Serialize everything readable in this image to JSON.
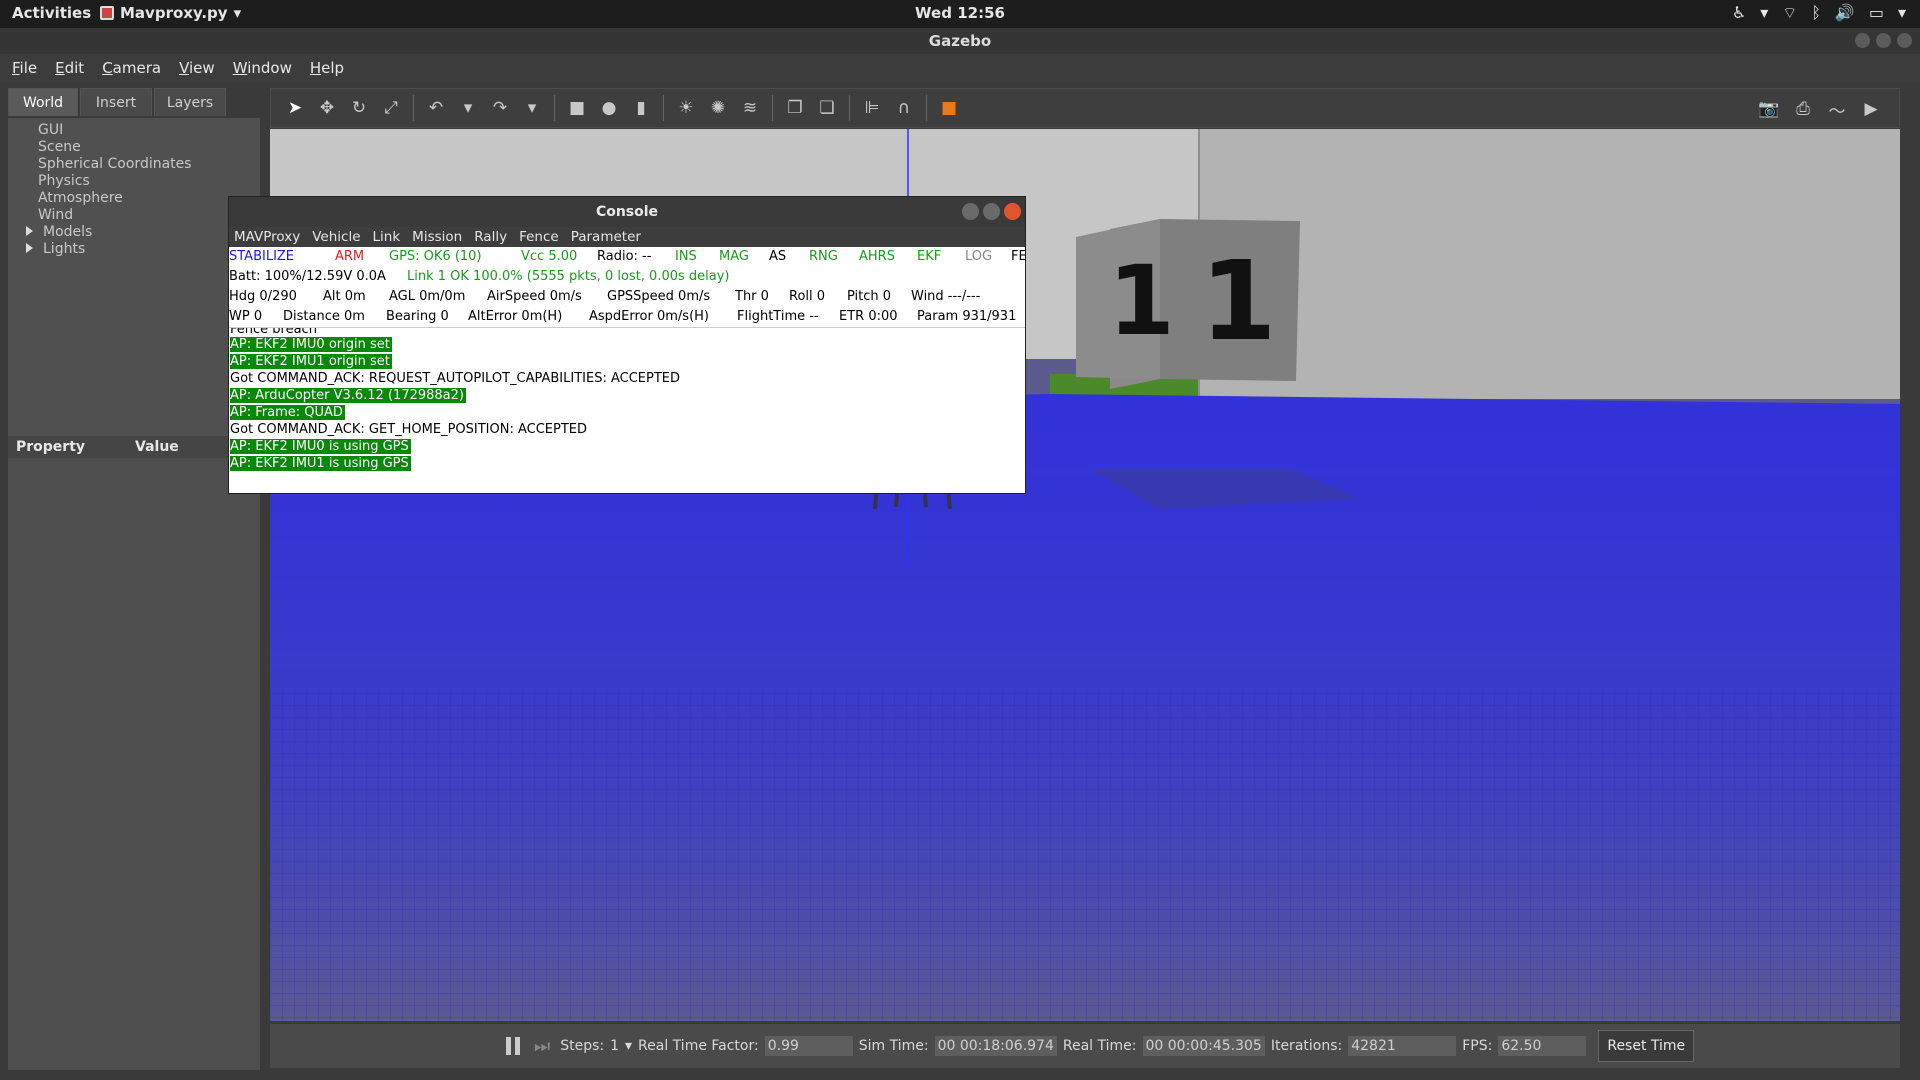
{
  "topbar": {
    "activities": "Activities",
    "app_name": "Mavproxy.py",
    "clock": "Wed 12:56"
  },
  "window": {
    "title": "Gazebo"
  },
  "menubar": {
    "items": [
      "File",
      "Edit",
      "Camera",
      "View",
      "Window",
      "Help"
    ]
  },
  "left_panel": {
    "tabs": [
      "World",
      "Insert",
      "Layers"
    ],
    "tree": [
      "GUI",
      "Scene",
      "Spherical Coordinates",
      "Physics",
      "Atmosphere",
      "Wind",
      "Models",
      "Lights"
    ],
    "property_header": "Property",
    "value_header": "Value"
  },
  "bottom_bar": {
    "steps_label": "Steps:",
    "steps_value": "1",
    "rtf_label": "Real Time Factor:",
    "rtf_value": "0.99",
    "sim_time_label": "Sim Time:",
    "sim_time_value": "00 00:18:06.974",
    "real_time_label": "Real Time:",
    "real_time_value": "00 00:00:45.305",
    "iterations_label": "Iterations:",
    "iterations_value": "42821",
    "fps_label": "FPS:",
    "fps_value": "62.50",
    "reset_button": "Reset Time"
  },
  "console": {
    "title": "Console",
    "menu": [
      "MAVProxy",
      "Vehicle",
      "Link",
      "Mission",
      "Rally",
      "Fence",
      "Parameter"
    ],
    "row1": {
      "mode": "STABILIZE",
      "arm": "ARM",
      "gps": "GPS: OK6 (10)",
      "vcc": "Vcc 5.00",
      "radio": "Radio: --",
      "ins": "INS",
      "mag": "MAG",
      "as": "AS",
      "rng": "RNG",
      "ahrs": "AHRS",
      "ekf": "EKF",
      "log": "LOG",
      "fe": "FE"
    },
    "row2": {
      "batt": "Batt: 100%/12.59V 0.0A",
      "link": "Link 1 OK 100.0% (5555 pkts, 0 lost, 0.00s delay)"
    },
    "row3": {
      "hdg": "Hdg  0/290",
      "alt": "Alt 0m",
      "agl": "AGL 0m/0m",
      "airspeed": "AirSpeed 0m/s",
      "gpsspeed": "GPSSpeed 0m/s",
      "thr": "Thr 0",
      "roll": "Roll 0",
      "pitch": "Pitch 0",
      "wind": "Wind ---/---"
    },
    "row4": {
      "wp": "WP 0",
      "distance": "Distance 0m",
      "bearing": "Bearing 0",
      "alterror": "AltError 0m(H)",
      "aspderror": "AspdError 0m/s(H)",
      "flighttime": "FlightTime --",
      "etr": "ETR 0:00",
      "param": "Param 931/931"
    },
    "log_cut": "Fence breach",
    "log": [
      {
        "text": "AP: EKF2 IMU0 origin set",
        "style": "g"
      },
      {
        "text": "AP: EKF2 IMU1 origin set",
        "style": "g"
      },
      {
        "text": "Got COMMAND_ACK: REQUEST_AUTOPILOT_CAPABILITIES: ACCEPTED",
        "style": "b"
      },
      {
        "text": "AP: ArduCopter V3.6.12 (172988a2)",
        "style": "g"
      },
      {
        "text": "AP: Frame: QUAD",
        "style": "g"
      },
      {
        "text": "Got COMMAND_ACK: GET_HOME_POSITION: ACCEPTED",
        "style": "b"
      },
      {
        "text": "AP: EKF2 IMU0 is using GPS",
        "style": "g"
      },
      {
        "text": "AP: EKF2 IMU1 is using GPS",
        "style": "g"
      }
    ]
  },
  "scene": {
    "box_label_left": "1",
    "box_label_right": "1"
  },
  "colors": {
    "ground": "#3434d8",
    "sky": "#bdbdbd",
    "log_highlight": "#0a880a"
  }
}
